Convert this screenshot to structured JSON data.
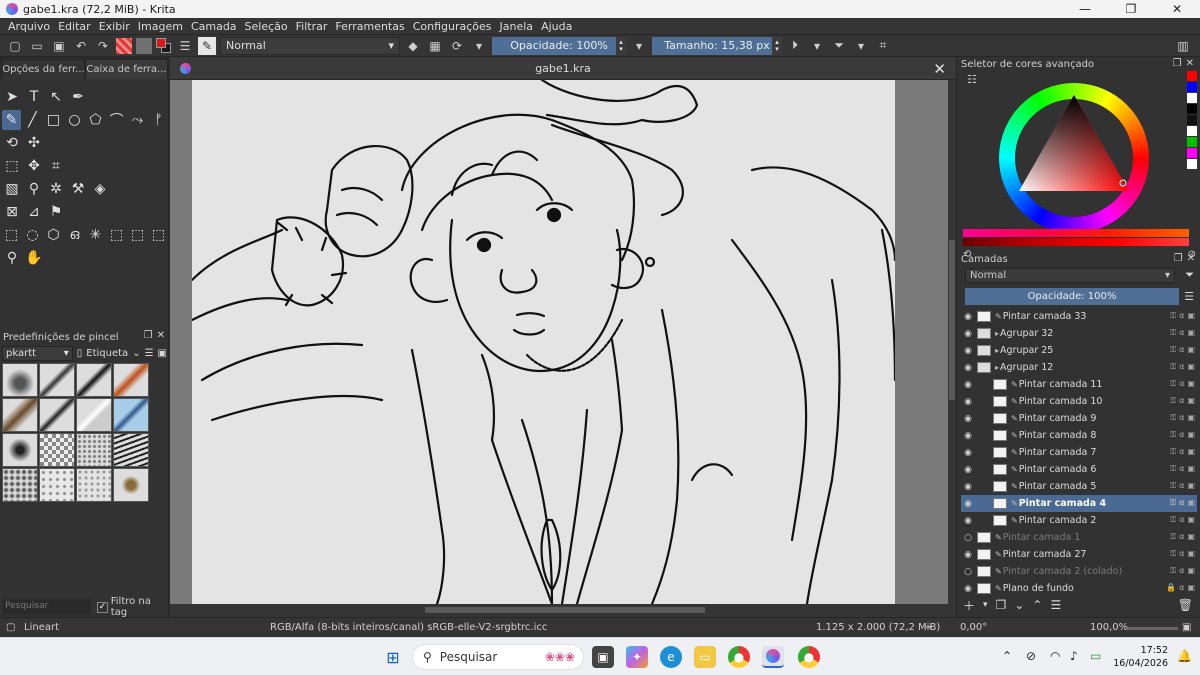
{
  "window": {
    "title": "gabe1.kra (72,2 MiB) - Krita",
    "minimize": "—",
    "maximize": "❐",
    "close": "✕"
  },
  "menu": [
    "Arquivo",
    "Editar",
    "Exibir",
    "Imagem",
    "Camada",
    "Seleção",
    "Filtrar",
    "Ferramentas",
    "Configurações",
    "Janela",
    "Ajuda"
  ],
  "toolbar": {
    "blend_mode": "Normal",
    "opacity": "Opacidade: 100%",
    "size": "Tamanho: 15,38 px",
    "fg_color": "#d91a1a",
    "bg_color": "#7a7a7a"
  },
  "left_panel": {
    "tabs": [
      "Opções da ferr...",
      "Caixa de ferra..."
    ],
    "brush_presets_title": "Predefinições de pincel",
    "brush_tag": "pkartt",
    "etiqueta": "Etiqueta",
    "search_placeholder": "Pesquisar",
    "filter_tag": "Filtro na tag"
  },
  "document": {
    "tab_title": "gabe1.kra",
    "close": "✕"
  },
  "right_panel": {
    "color_selector_title": "Seletor de cores avançado",
    "recent_colors": [
      "#ff0000",
      "#0000ff",
      "#ffffff",
      "#000000",
      "#111111",
      "#ffffff",
      "#00c000",
      "#ff00ff",
      "#ffffff"
    ],
    "layers_title": "Camadas",
    "layers_blend": "Normal",
    "layers_opacity": "Opacidade:  100%",
    "layers": [
      {
        "name": "Pintar camada 33",
        "indent": 0,
        "group": false,
        "visible": true,
        "selected": false,
        "locked": false
      },
      {
        "name": "Agrupar  32",
        "indent": 0,
        "group": true,
        "visible": true,
        "selected": false,
        "locked": false
      },
      {
        "name": "Agrupar  25",
        "indent": 0,
        "group": true,
        "visible": true,
        "selected": false,
        "locked": false
      },
      {
        "name": "Agrupar  12",
        "indent": 0,
        "group": true,
        "visible": true,
        "selected": false,
        "locked": false
      },
      {
        "name": "Pintar camada 11",
        "indent": 1,
        "group": false,
        "visible": true,
        "selected": false,
        "locked": false
      },
      {
        "name": "Pintar camada 10",
        "indent": 1,
        "group": false,
        "visible": true,
        "selected": false,
        "locked": false
      },
      {
        "name": "Pintar camada 9",
        "indent": 1,
        "group": false,
        "visible": true,
        "selected": false,
        "locked": false
      },
      {
        "name": "Pintar camada 8",
        "indent": 1,
        "group": false,
        "visible": true,
        "selected": false,
        "locked": false
      },
      {
        "name": "Pintar camada 7",
        "indent": 1,
        "group": false,
        "visible": true,
        "selected": false,
        "locked": false
      },
      {
        "name": "Pintar camada 6",
        "indent": 1,
        "group": false,
        "visible": true,
        "selected": false,
        "locked": false
      },
      {
        "name": "Pintar camada 5",
        "indent": 1,
        "group": false,
        "visible": true,
        "selected": false,
        "locked": false
      },
      {
        "name": "Pintar camada 4",
        "indent": 1,
        "group": false,
        "visible": true,
        "selected": true,
        "locked": false
      },
      {
        "name": "Pintar camada 2",
        "indent": 1,
        "group": false,
        "visible": true,
        "selected": false,
        "locked": false
      },
      {
        "name": "Pintar camada 1",
        "indent": 0,
        "group": false,
        "visible": false,
        "selected": false,
        "locked": false
      },
      {
        "name": "Pintar camada 27",
        "indent": 0,
        "group": false,
        "visible": true,
        "selected": false,
        "locked": false
      },
      {
        "name": "Pintar camada 2 (colado)",
        "indent": 0,
        "group": false,
        "visible": false,
        "selected": false,
        "locked": false
      },
      {
        "name": "Plano de fundo",
        "indent": 0,
        "group": false,
        "visible": true,
        "selected": false,
        "locked": true
      }
    ]
  },
  "status": {
    "brush_name": "Lineart",
    "color_info": "RGB/Alfa (8-bits inteiros/canal)  sRGB-elle-V2-srgbtrc.icc",
    "dimensions": "1.125 x 2.000 (72,2 MiB)",
    "rotation": "0,00°",
    "zoom": "100,0%"
  },
  "taskbar": {
    "search": "Pesquisar",
    "time": "17:52",
    "date": "16/04/2026"
  }
}
